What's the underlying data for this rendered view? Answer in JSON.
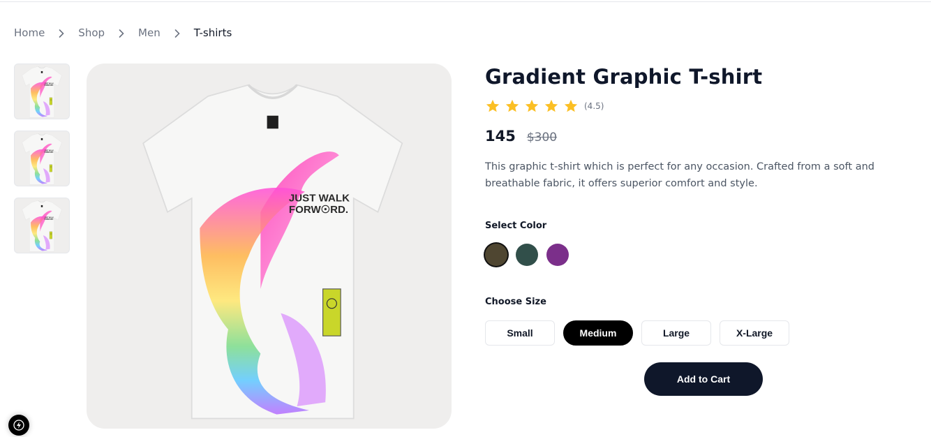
{
  "breadcrumb": {
    "items": [
      {
        "label": "Home"
      },
      {
        "label": "Shop"
      },
      {
        "label": "Men"
      },
      {
        "label": "T-shirts"
      }
    ]
  },
  "product": {
    "title": "Gradient Graphic T-shirt",
    "rating": {
      "stars": 5,
      "value_text": "(4.5)"
    },
    "price": "145",
    "old_price": "$300",
    "description": "This graphic t-shirt which is perfect for any occasion. Crafted from a soft and breathable fabric, it offers superior comfort and style.",
    "print_text": "JUST WALK FORW☉RD.",
    "thumbnails": 3
  },
  "colors": {
    "label": "Select Color",
    "options": [
      {
        "hex": "#4f4631",
        "selected": true
      },
      {
        "hex": "#314f4a",
        "selected": false
      },
      {
        "hex": "#7b2f8a",
        "selected": false
      }
    ]
  },
  "sizes": {
    "label": "Choose Size",
    "options": [
      {
        "label": "Small",
        "selected": false
      },
      {
        "label": "Medium",
        "selected": true
      },
      {
        "label": "Large",
        "selected": false
      },
      {
        "label": "X-Large",
        "selected": false
      }
    ]
  },
  "actions": {
    "add_to_cart_label": "Add to Cart"
  },
  "theme": {
    "accent": "#0f172a",
    "star": "#fbbf24",
    "image_bg": "#efeeed"
  },
  "icons": {
    "separator": "chevron-right-icon",
    "star": "star-icon",
    "badge": "lightning-icon"
  }
}
